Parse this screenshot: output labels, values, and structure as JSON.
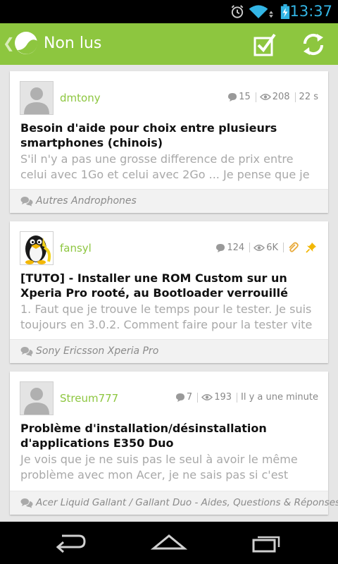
{
  "status_bar": {
    "time": "13:37",
    "icons": [
      "alarm-icon",
      "wifi-icon",
      "battery-charging-icon"
    ]
  },
  "action_bar": {
    "title": "Non lus",
    "up_glyph": "❮",
    "actions": [
      "mark-read-icon",
      "refresh-icon"
    ],
    "color": "#8dc63f"
  },
  "posts": [
    {
      "author": "dmtony",
      "replies": "15",
      "views": "208",
      "time": "22 s",
      "title": "Besoin d'aide pour choix entre plusieurs smartphones (chinois)",
      "excerpt": "S'il n'y a pas une grosse difference de prix entre celui avec 1Go et celui avec 2Go ... Je pense que je",
      "forum": "Autres Androphones"
    },
    {
      "author": "fansyl",
      "replies": "124",
      "views": "6K",
      "title": "[TUTO] - Installer une ROM Custom sur un Xperia Pro rooté, au Bootloader verrouillé",
      "excerpt": "1. Faut que je trouve le temps pour le tester. Je suis toujours en 3.0.2. Comment faire pour la tester vite",
      "forum": "Sony Ericsson Xperia Pro"
    },
    {
      "author": "Streum777",
      "replies": "7",
      "views": "193",
      "time": "Il y a une minute",
      "title": "Problème d'installation/désinstallation d'applications E350 Duo",
      "excerpt": "Je vois que je ne suis pas le seul à avoir le même problème avec mon Acer, je ne sais pas si c'est",
      "forum": "Acer Liquid Gallant / Gallant Duo - Aides, Questions & Réponses"
    }
  ]
}
